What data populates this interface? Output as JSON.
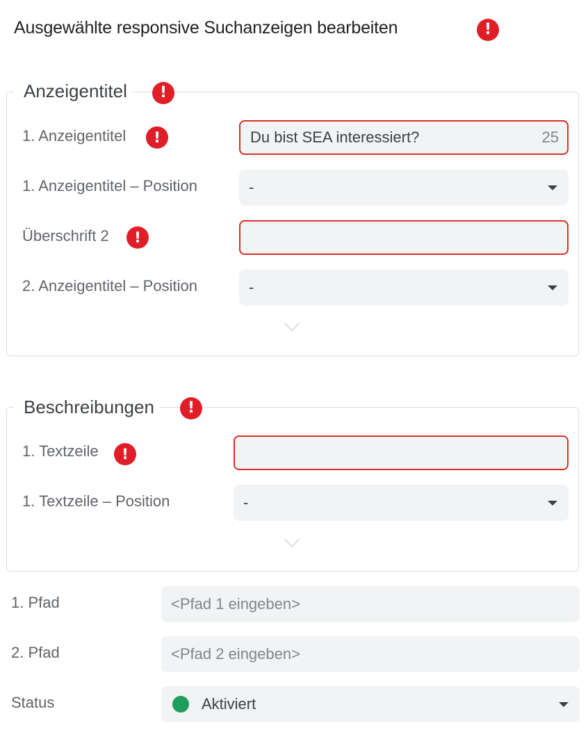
{
  "title": "Ausgewählte responsive Suchanzeigen bearbeiten",
  "colors": {
    "error": "#e01e28",
    "field_bg": "#f1f3f4",
    "status_active": "#1e9e5a"
  },
  "headlines_section": {
    "title": "Anzeigentitel",
    "rows": [
      {
        "label": "1. Anzeigentitel",
        "value": "Du bist SEA interessiert?",
        "counter": "25"
      },
      {
        "label": "1. Anzeigentitel – Position",
        "value": "-"
      },
      {
        "label": "Überschrift 2",
        "value": ""
      },
      {
        "label": "2. Anzeigentitel – Position",
        "value": "-"
      }
    ]
  },
  "descriptions_section": {
    "title": "Beschreibungen",
    "rows": [
      {
        "label": "1. Textzeile",
        "value": ""
      },
      {
        "label": "1. Textzeile – Position",
        "value": "-"
      }
    ]
  },
  "paths": [
    {
      "label": "1. Pfad",
      "placeholder": "<Pfad 1 eingeben>"
    },
    {
      "label": "2. Pfad",
      "placeholder": "<Pfad 2 eingeben>"
    }
  ],
  "status": {
    "label": "Status",
    "value": "Aktiviert"
  },
  "icons": {
    "error": "exclamation-error-icon",
    "dropdown": "dropdown-arrow-icon",
    "expand": "chevron-down-icon"
  }
}
